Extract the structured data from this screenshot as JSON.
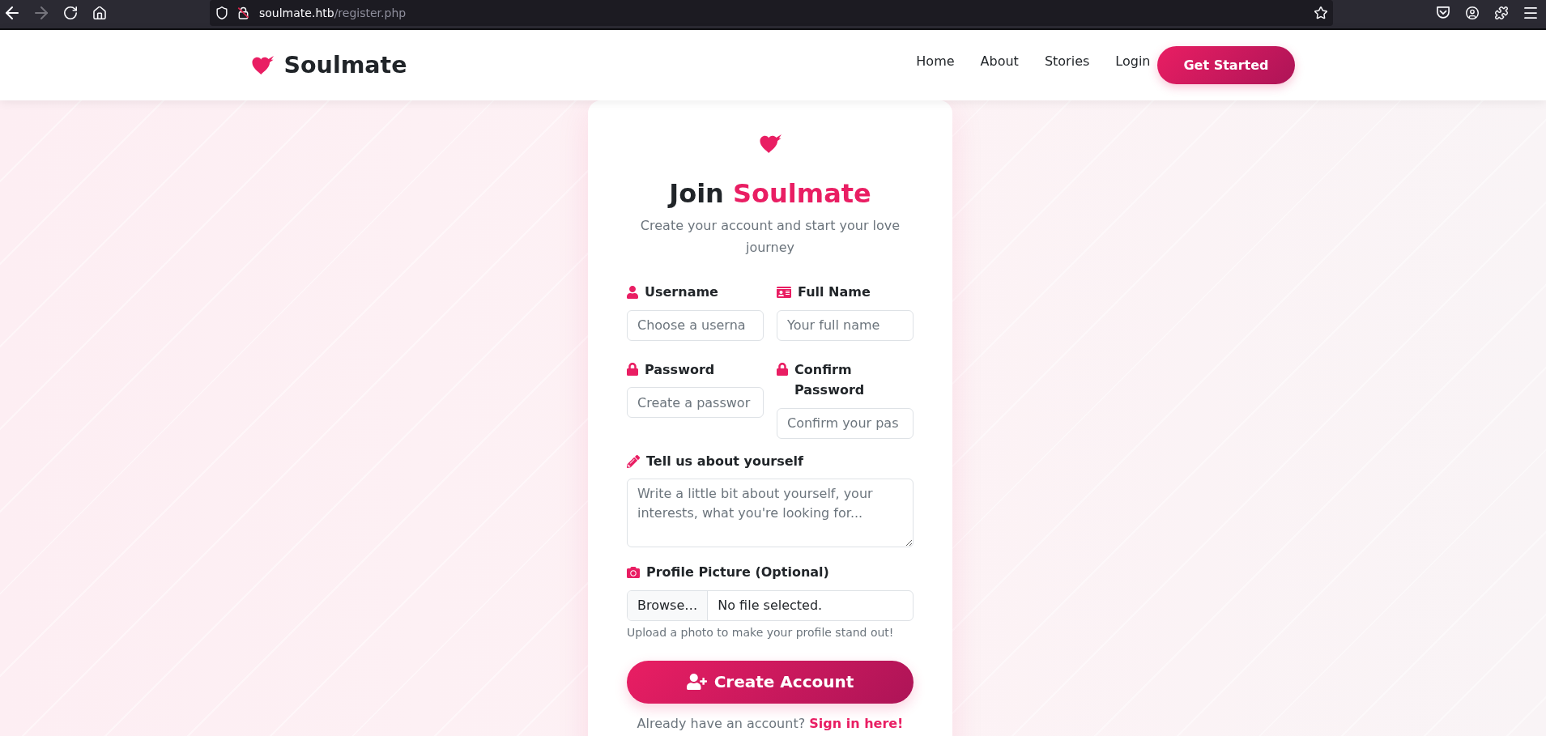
{
  "browser": {
    "toolbar_buttons": [
      {
        "disabled": false
      },
      {
        "disabled": true
      },
      {
        "disabled": false
      },
      {
        "disabled": false
      }
    ],
    "url": {
      "host": "soulmate.htb",
      "path": "/register.php"
    }
  },
  "navbar": {
    "brand": "Soulmate",
    "links": [
      "Home",
      "About",
      "Stories",
      "Login"
    ],
    "cta": "Get Started"
  },
  "register_card": {
    "title": {
      "text": "Join",
      "highlight": "Soulmate"
    },
    "subtitle": "Create your account and start your love journey",
    "field_rows": [
      [
        {
          "label": "Username",
          "placeholder": "Choose a userna"
        },
        {
          "label": "Full Name",
          "placeholder": "Your full name"
        }
      ],
      [
        {
          "label": "Password",
          "placeholder": "Create a passwor"
        },
        {
          "label": "Confirm Password",
          "placeholder": "Confirm your pas"
        }
      ]
    ],
    "about": {
      "label": "Tell us about yourself",
      "placeholder": "Write a little bit about yourself, your interests, what you're looking for..."
    },
    "profile_picture": {
      "label": "Profile Picture (Optional)",
      "browse_button": "Browse…",
      "file_status": "No file selected.",
      "help": "Upload a photo to make your profile stand out!"
    },
    "submit": "Create Account",
    "signin": {
      "text": "Already have an account?",
      "link": "Sign in here!"
    }
  }
}
